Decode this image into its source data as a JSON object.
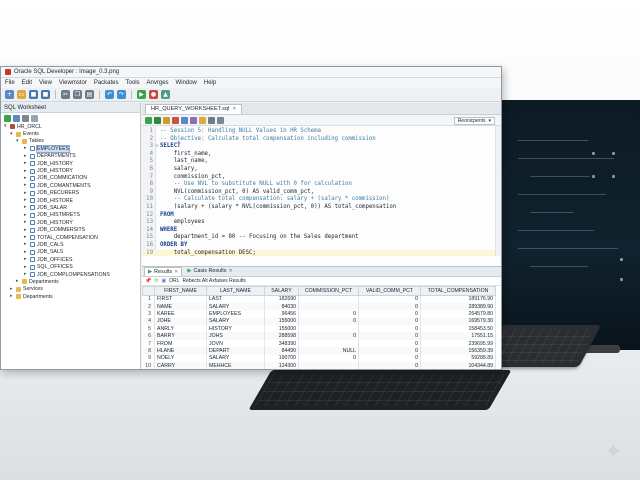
{
  "window": {
    "title": "Oracle SQL Developer : Image_0.3.png"
  },
  "menu": [
    "File",
    "Edit",
    "View",
    "Viewmstor",
    "Packates",
    "Tools",
    "Anvrges",
    "Window",
    "Help"
  ],
  "navigator": {
    "header": "SQL Worksheet",
    "connection": "HR_ORCL",
    "events_label": "Events",
    "tables_label": "Tables",
    "tables": [
      "EMPLOYEES",
      "DEPARTMENTS",
      "JOB_HISTORY",
      "JOB_HISTORY",
      "JOB_COMMICATION",
      "JOB_COMANTMENTS",
      "JOB_RECURERS",
      "JOB_HISTORE",
      "JOB_SALAR",
      "JOB_HISTMRETS",
      "JOB_HISTORY",
      "JOB_COMMERSITS",
      "TOTAL_COMPENSATION",
      "JOB_CALS",
      "JOB_SALS",
      "JOB_OFFICES",
      "SQL_OFFICES",
      "JOB_COMPLOMPENSATIONS"
    ],
    "selected_table": "EMPLOYEES",
    "departments_label": "Departments",
    "services_label": "Services",
    "departments2_label": "Departments"
  },
  "editor": {
    "tab_label": "HR_QUERY_WORKSHEET.sql",
    "connection_label": "Reonicpents",
    "lines": [
      {
        "n": "1",
        "text": "-- Session 5: Handling NULL Values in HR Schema",
        "kind": "comment"
      },
      {
        "n": "2",
        "text": "-- Objective: Calculate total compensation including commission",
        "kind": "comment"
      },
      {
        "n": "3",
        "text": "SELECT",
        "kind": "keyword"
      },
      {
        "n": "4",
        "text": "    first_name,",
        "kind": "plain"
      },
      {
        "n": "5",
        "text": "    last_name,",
        "kind": "plain"
      },
      {
        "n": "6",
        "text": "    salary,",
        "kind": "plain"
      },
      {
        "n": "7",
        "text": "    commission_pct,",
        "kind": "plain"
      },
      {
        "n": "8",
        "text": "    -- Use NVL to substitute NULL with 0 for calculation",
        "kind": "comment"
      },
      {
        "n": "9",
        "text": "    NVL(commission_pct, 0) AS valid_comm_pct,",
        "kind": "plain"
      },
      {
        "n": "10",
        "text": "    -- Calculate total compensation: salary + (salary * commission)",
        "kind": "comment"
      },
      {
        "n": "11",
        "text": "    (salary + (salary * NVL(commission_pct, 0)) AS total_compensation",
        "kind": "plain"
      },
      {
        "n": "12",
        "text": "FROM",
        "kind": "keyword"
      },
      {
        "n": "13",
        "text": "    employees",
        "kind": "plain"
      },
      {
        "n": "14",
        "text": "WHERE",
        "kind": "keyword"
      },
      {
        "n": "15",
        "text": "    department_id = 80 -- Focusing on the Sales department",
        "kind": "plain"
      },
      {
        "n": "16",
        "text": "ORDER BY",
        "kind": "keyword"
      },
      {
        "n": "19",
        "text": "    total_compensation DESC;",
        "kind": "current"
      }
    ]
  },
  "results": {
    "tab1": "Results",
    "tab2": "Casis Results",
    "tools_text": "Rebects Alt Axfaises Results",
    "sql_label": "ORL",
    "columns": [
      "",
      "FIRST_NAME",
      "LAST_NAME",
      "SALARY",
      "COMMISSION_PCT",
      "VALID_COMM_PCT",
      "TOTAL_COMPENSATION"
    ],
    "rows": [
      [
        "1",
        "FIRST",
        "LAST",
        "182690",
        "",
        "0",
        "189176.90"
      ],
      [
        "2",
        "NAME",
        "SALARY",
        "84030",
        "",
        "0",
        "289389.90"
      ],
      [
        "3",
        "KAREE",
        "EMPLOYEES",
        "96456",
        "0",
        "0",
        "264579.80"
      ],
      [
        "4",
        "JOHE",
        "SALARY",
        "155000",
        "0",
        "0",
        "169579.30"
      ],
      [
        "5",
        "ANRLY",
        "HISTORY",
        "155000",
        "",
        "0",
        "158453.50"
      ],
      [
        "6",
        "BARRY",
        "JOHS",
        "288598",
        "0",
        "0",
        "17551.15"
      ],
      [
        "7",
        "FROM",
        "JOVN",
        "348390",
        "",
        "0",
        "239695.99"
      ],
      [
        "8",
        "HLANE",
        "DEPART",
        "84490",
        "NULL",
        "0",
        "156359.39"
      ],
      [
        "9",
        "NOELY",
        "SALARY",
        "190700",
        "0",
        "0",
        "59288.89"
      ],
      [
        "10",
        "CARRY",
        "MEHHCE",
        "124300",
        "",
        "0",
        "104344.89"
      ]
    ]
  }
}
